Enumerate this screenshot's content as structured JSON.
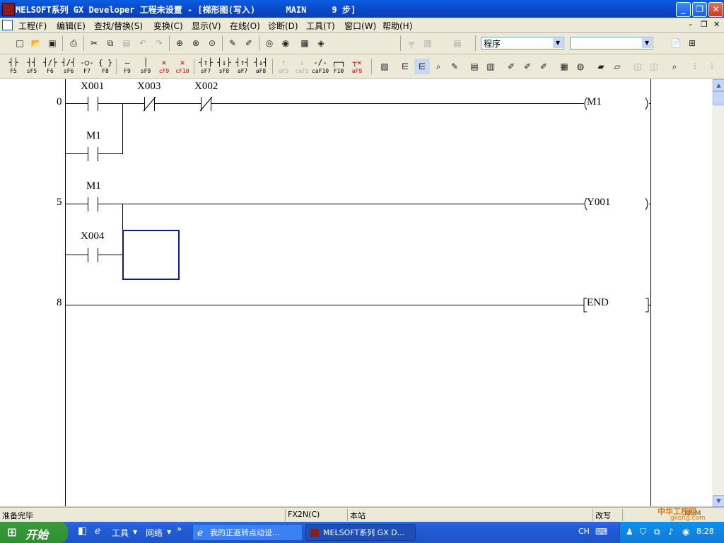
{
  "window": {
    "title": "MELSOFT系列 GX Developer 工程未设置 - [梯形图(写入)      MAIN     9 步]"
  },
  "menubar": {
    "items": [
      "工程(F)",
      "编辑(E)",
      "查找/替换(S)",
      "变换(C)",
      "显示(V)",
      "在线(O)",
      "诊断(D)",
      "工具(T)",
      "窗口(W)",
      "帮助(H)"
    ]
  },
  "toolbar": {
    "program_combo": "程序",
    "second_combo": ""
  },
  "fkeys": [
    {
      "label": "F5",
      "sym": "┤├"
    },
    {
      "label": "sF5",
      "sym": "┤┤"
    },
    {
      "label": "F6",
      "sym": "┤/├"
    },
    {
      "label": "sF6",
      "sym": "┤/┤"
    },
    {
      "label": "F7",
      "sym": "-○-"
    },
    {
      "label": "F8",
      "sym": "{ }"
    },
    {
      "label": "F9",
      "sym": "—"
    },
    {
      "label": "sF9",
      "sym": "│"
    },
    {
      "label": "cF9",
      "sym": "✕"
    },
    {
      "label": "cF10",
      "sym": "✕"
    },
    {
      "label": "sF7",
      "sym": "┤↑├"
    },
    {
      "label": "sF8",
      "sym": "┤↓├"
    },
    {
      "label": "aF7",
      "sym": "┤↑┤"
    },
    {
      "label": "aF8",
      "sym": "┤↓┤"
    },
    {
      "label": "aF5",
      "sym": "↑"
    },
    {
      "label": "caF5",
      "sym": "↓"
    },
    {
      "label": "caF10",
      "sym": "-/-"
    },
    {
      "label": "F10",
      "sym": "┌─┐"
    },
    {
      "label": "aF9",
      "sym": "┬✕"
    }
  ],
  "ladder": {
    "steps": [
      {
        "num": "0",
        "contacts": [
          "X001",
          "X003",
          "X002"
        ],
        "branch": "M1",
        "coil": "M1"
      },
      {
        "num": "5",
        "contacts": [
          "M1"
        ],
        "branch": "X004",
        "coil": "Y001"
      },
      {
        "num": "8",
        "coil": "END"
      }
    ]
  },
  "statusbar": {
    "ready": "准备完毕",
    "plc": "FX2N(C)",
    "station": "本站",
    "mode": "改写",
    "num": "NUM"
  },
  "taskbar": {
    "start": "开始",
    "tools": "工具",
    "network": "网络",
    "more": "»",
    "task1": "我的正返转点动设...",
    "task2": "MELSOFT系列 GX D...",
    "lang": "CH",
    "clock": "8:28",
    "watermark_site": "gkong.com",
    "watermark_name": "中华工控网"
  }
}
